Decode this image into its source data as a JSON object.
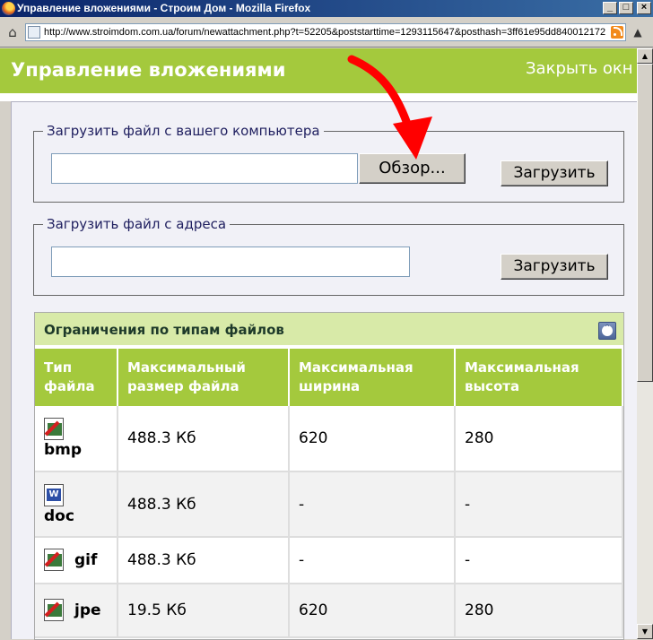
{
  "window": {
    "title": "Управление вложениями - Строим Дом - Mozilla Firefox",
    "buttons": [
      "_",
      "□",
      "×"
    ]
  },
  "address_bar": {
    "url": "http://www.stroimdom.com.ua/forum/newattachment.php?t=52205&poststarttime=1293115647&posthash=3ff61e95dd840012172"
  },
  "header": {
    "title": "Управление вложениями",
    "close_link": "Закрыть окн"
  },
  "upload_local": {
    "legend": "Загрузить файл с вашего компьютера",
    "input_value": "",
    "browse_label": "Обзор...",
    "upload_label": "Загрузить"
  },
  "upload_url": {
    "legend": "Загрузить файл с адреса",
    "input_value": "",
    "upload_label": "Загрузить"
  },
  "limits": {
    "title": "Ограничения по типам файлов",
    "headers": [
      "Тип файла",
      "Максимальный размер файла",
      "Максимальная ширина",
      "Максимальная высота"
    ],
    "rows": [
      {
        "type": "bmp",
        "icon": "image-file-icon",
        "size": "488.3 Кб",
        "width": "620",
        "height": "280"
      },
      {
        "type": "doc",
        "icon": "word-file-icon",
        "size": "488.3 Кб",
        "width": "-",
        "height": "-"
      },
      {
        "type": "gif",
        "icon": "image-file-icon",
        "size": "488.3 Кб",
        "width": "-",
        "height": "-"
      },
      {
        "type": "jpe",
        "icon": "image-file-icon",
        "size": "19.5 Кб",
        "width": "620",
        "height": "280"
      }
    ]
  },
  "colors": {
    "header_green": "#a4c93d",
    "table_head_light": "#d8eaa8",
    "arrow_red": "#ff0000"
  }
}
